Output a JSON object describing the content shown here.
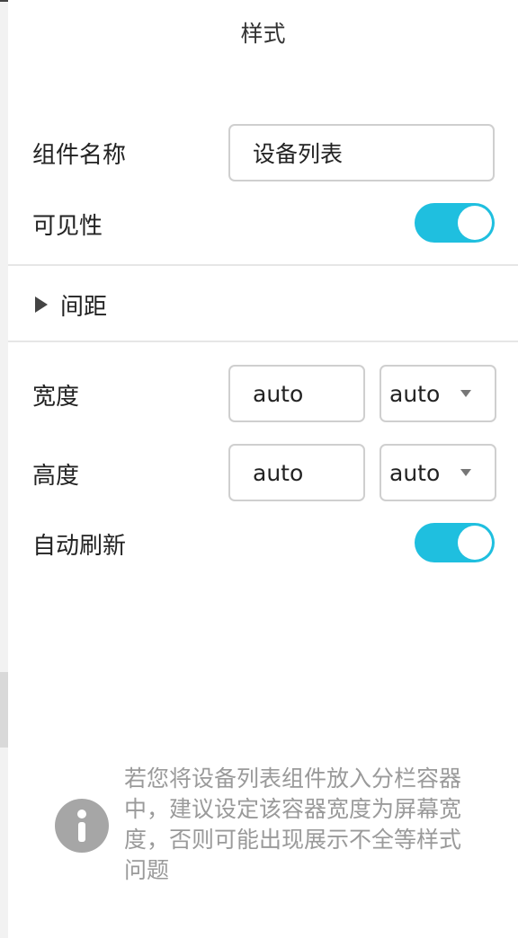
{
  "panel": {
    "title": "样式"
  },
  "component_name": {
    "label": "组件名称",
    "value": "设备列表"
  },
  "visibility": {
    "label": "可见性",
    "on": true
  },
  "spacing": {
    "label": "间距",
    "expanded": false
  },
  "width": {
    "label": "宽度",
    "value": "auto",
    "unit": "auto"
  },
  "height": {
    "label": "高度",
    "value": "auto",
    "unit": "auto"
  },
  "auto_refresh": {
    "label": "自动刷新",
    "on": true
  },
  "note": {
    "text": "若您将设备列表组件放入分栏容器中，建议设定该容器宽度为屏幕宽度，否则可能出现展示不全等样式问题"
  },
  "colors": {
    "accent": "#1fbfdf",
    "note_text": "#9a9a9a",
    "info_icon": "#a6a6a6"
  }
}
